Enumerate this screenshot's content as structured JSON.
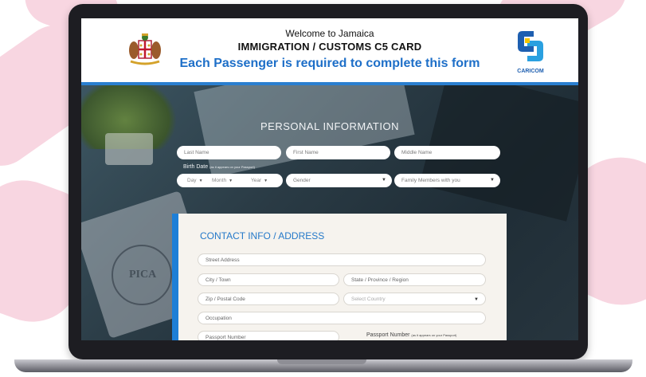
{
  "header": {
    "welcome": "Welcome to Jamaica",
    "title": "IMMIGRATION / CUSTOMS C5 CARD",
    "subtitle": "Each Passenger is required to complete this form",
    "caricom_label": "CARICOM"
  },
  "personal": {
    "section_title": "PERSONAL INFORMATION",
    "last_name_placeholder": "Last Name",
    "first_name_placeholder": "First Name",
    "middle_name_placeholder": "Middle Name",
    "birth_date_label": "Birth Date",
    "birth_date_hint": "(as it appears on your Passport)",
    "day_label": "Day",
    "month_label": "Month",
    "year_label": "Year",
    "gender_label": "Gender",
    "family_label": "Family Members with you"
  },
  "contact": {
    "section_title": "CONTACT INFO / ADDRESS",
    "street_placeholder": "Street Address",
    "city_placeholder": "City / Town",
    "state_placeholder": "State / Province / Region",
    "zip_placeholder": "Zip / Postal Code",
    "country_label": "Select Country",
    "occupation_placeholder": "Occupation",
    "passport_number_placeholder": "Passport Number",
    "passport_number_label": "Passport Number",
    "passport_number_hint": "(as it appears on your Passport)"
  },
  "photo": {
    "stamp_text": "PICA"
  },
  "icons": {
    "dropdown": "chevron-down-icon"
  },
  "colors": {
    "accent_blue": "#1e6fc8",
    "header_line": "#2a7fd0",
    "contact_bar": "#1e7fd6",
    "background_pink": "#f8d6e1"
  }
}
